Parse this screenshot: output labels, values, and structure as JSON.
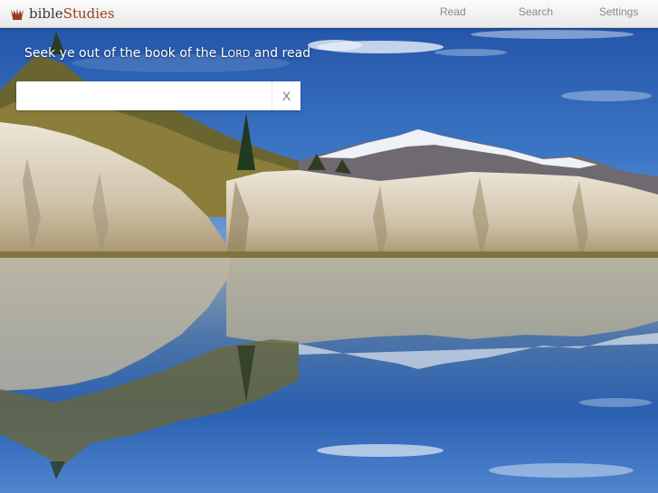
{
  "brand": {
    "name_part1": "bible",
    "name_part2": "Studies",
    "icon": "crown-hand-icon",
    "color_part2": "#9c3b1e"
  },
  "nav": {
    "read": "Read",
    "search": "Search",
    "settings": "Settings"
  },
  "verse": {
    "before": "Seek ye out of the book of the ",
    "lord_first": "L",
    "lord_rest": "ORD",
    "after": " and read"
  },
  "search": {
    "value": "",
    "placeholder": "",
    "clear_label": "X"
  },
  "background": {
    "description_icon": "landscape-lake-photo",
    "sky_color": "#2f64b8",
    "water_color": "#1d58b0"
  }
}
